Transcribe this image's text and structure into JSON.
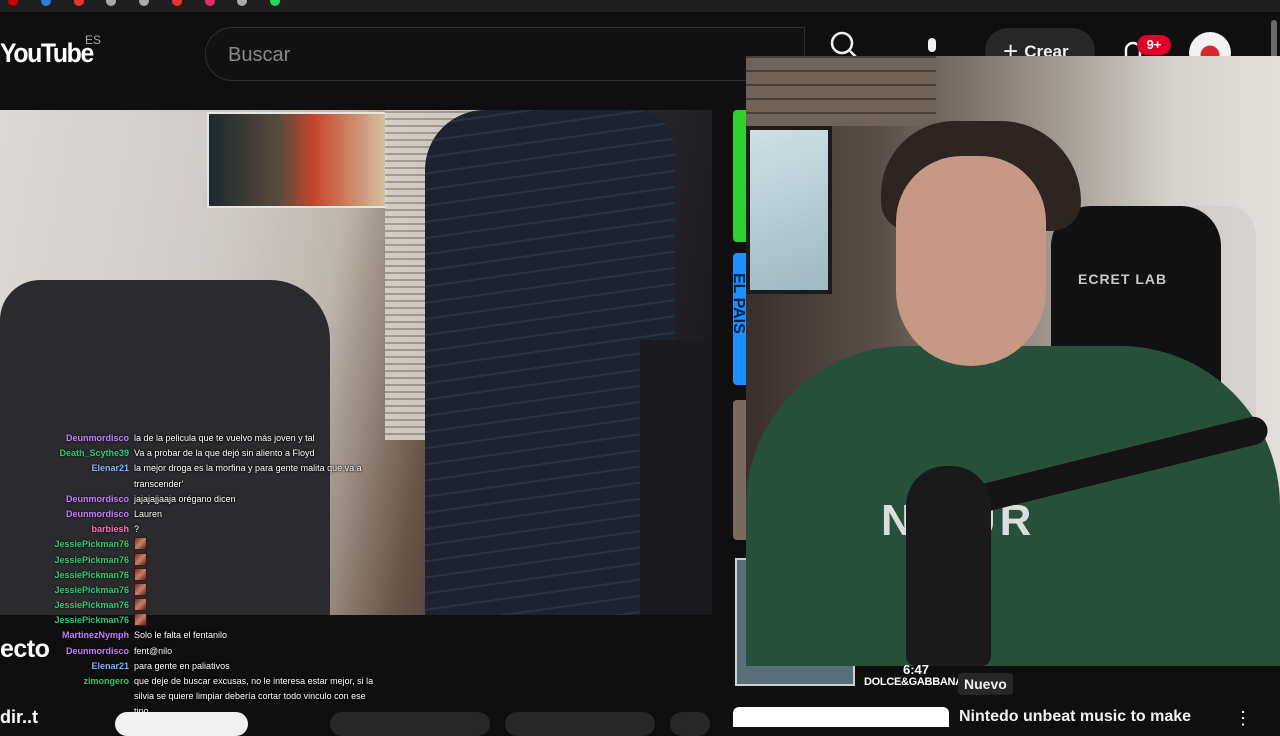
{
  "header": {
    "logo_text": "YouTube",
    "country_code": "ES",
    "search_placeholder": "Buscar",
    "create_label": "Crear",
    "notification_count": "9+"
  },
  "chat": {
    "messages": [
      {
        "user": "Deunmordisco",
        "color": "#c77dff",
        "text": "la de la pelicula que te vuelvo más joven y tal",
        "emote": false
      },
      {
        "user": "Death_Scythe39",
        "color": "#2ecc71",
        "text": "Va a probar de la que dejó sin aliento a Floyd",
        "emote": false
      },
      {
        "user": "Elenar21",
        "color": "#7fb3ff",
        "text": "la mejor droga es la morfina y para gente malita que va a transcender'",
        "emote": false,
        "wrap": true
      },
      {
        "user": "Deunmordisco",
        "color": "#c77dff",
        "text": "jajajajjaaja orégano dicen",
        "emote": false
      },
      {
        "user": "Deunmordisco",
        "color": "#c77dff",
        "text": "Lauren",
        "emote": false
      },
      {
        "user": "barbiesh",
        "color": "#ff6eb4",
        "text": "?",
        "emote": false
      },
      {
        "user": "JessiePickman76",
        "color": "#2ecc71",
        "text": "",
        "emote": true
      },
      {
        "user": "JessiePickman76",
        "color": "#2ecc71",
        "text": "",
        "emote": true
      },
      {
        "user": "JessiePickman76",
        "color": "#2ecc71",
        "text": "",
        "emote": true
      },
      {
        "user": "JessiePickman76",
        "color": "#2ecc71",
        "text": "",
        "emote": true
      },
      {
        "user": "JessiePickman76",
        "color": "#2ecc71",
        "text": "",
        "emote": true
      },
      {
        "user": "JessiePickman76",
        "color": "#2ecc71",
        "text": "",
        "emote": true
      },
      {
        "user": "MartinezNymph",
        "color": "#c77dff",
        "text": "Solo le falta el fentanilo",
        "emote": false
      },
      {
        "user": "Deunmordisco",
        "color": "#c77dff",
        "text": "fent@nilo",
        "emote": false
      },
      {
        "user": "Elenar21",
        "color": "#7fb3ff",
        "text": "para gente en paliativos",
        "emote": false
      },
      {
        "user": "zimongero",
        "color": "#2ecc71",
        "text": "que deje de buscar excusas, no le interesa estar mejor, si la silvia se quiere limpiar debería cortar todo vinculo con ese tipo",
        "emote": false,
        "wrap": true
      }
    ]
  },
  "video": {
    "title_fragment": "ecto",
    "bottom_fragment": "dir..t"
  },
  "webcam": {
    "chair_brand": "ECRET LAB",
    "shirt_text": "N  TUR"
  },
  "sidebar": {
    "strip_label": "EL PAÍS"
  },
  "recommendation": {
    "duration": "6:47",
    "thumb_brand": "DOLCE&GABBANA",
    "new_badge": "Nuevo",
    "next_title": "Nintedo unbeat music to make"
  },
  "colors": {
    "background": "#0f0f0f",
    "notification_badge": "#e0002a",
    "strip_green": "#2ed12e",
    "strip_blue": "#1e90ff"
  }
}
